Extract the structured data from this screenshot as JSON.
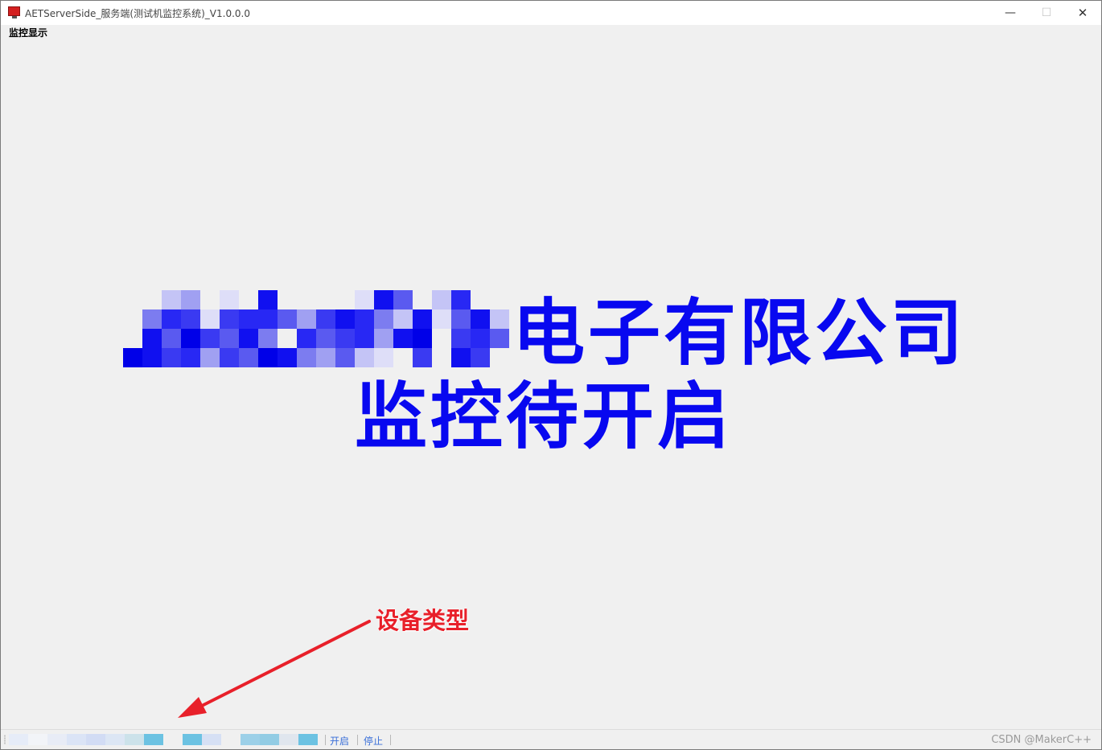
{
  "window": {
    "title": "AETServerSide_服务端(测试机监控系统)_V1.0.0.0",
    "minimize_glyph": "—",
    "maximize_glyph": "☐",
    "close_glyph": "✕"
  },
  "menu": {
    "items": [
      {
        "label": "监控显示"
      }
    ]
  },
  "banner": {
    "company_suffix": "电子有限公司",
    "status_text": "监控待开启",
    "text_color": "#0808f0"
  },
  "annotation": {
    "label": "设备类型",
    "color": "#e8202a"
  },
  "statusbar": {
    "start_label": "开启",
    "stop_label": "停止",
    "watermark": "CSDN @MakerC++"
  },
  "icons": {
    "app": "app-icon",
    "grip": "grip-icon"
  }
}
